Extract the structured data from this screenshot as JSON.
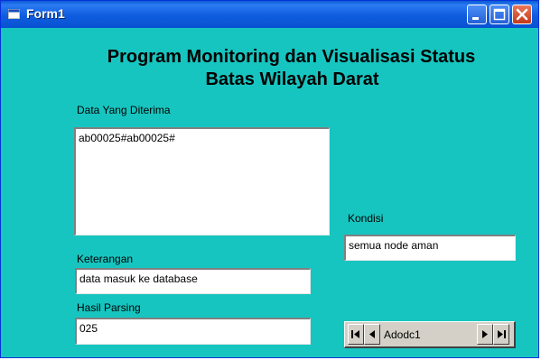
{
  "window": {
    "title": "Form1"
  },
  "heading": {
    "line1": "Program Monitoring dan Visualisasi Status",
    "line2": "Batas Wilayah Darat"
  },
  "data_received": {
    "label": "Data Yang Diterima",
    "value": "ab00025#ab00025#"
  },
  "condition": {
    "label": "Kondisi",
    "value": "semua node aman"
  },
  "remarks": {
    "label": "Keterangan",
    "value": "data masuk ke database"
  },
  "parse_result": {
    "label": "Hasil Parsing",
    "value": "025"
  },
  "ado_control": {
    "caption": "Adodc1"
  },
  "colors": {
    "form_background": "#17c5c0",
    "titlebar": "#0a5bd6"
  },
  "icons": [
    "app-icon",
    "minimize-icon",
    "maximize-icon",
    "close-icon",
    "first-record-icon",
    "previous-record-icon",
    "next-record-icon",
    "last-record-icon"
  ]
}
